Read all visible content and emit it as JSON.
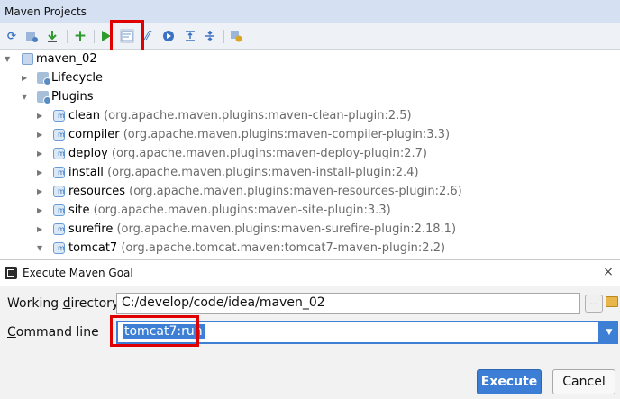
{
  "panel": {
    "title": "Maven Projects"
  },
  "toolbar": {
    "icons": [
      "refresh-icon",
      "generate-sources-icon",
      "download-icon",
      "add-icon",
      "run-icon",
      "execute-goal-icon",
      "toggle-offline-icon",
      "skip-tests-icon",
      "expand-all-icon",
      "collapse-all-icon",
      "settings-icon"
    ],
    "colors": {
      "run": "#2e9b2e",
      "add": "#2e9b2e",
      "highlight": "#e00000"
    }
  },
  "tree": {
    "project": "maven_02",
    "lifecycle": "Lifecycle",
    "plugins": "Plugins",
    "plugin_list": [
      {
        "name": "clean",
        "coord": "(org.apache.maven.plugins:maven-clean-plugin:2.5)"
      },
      {
        "name": "compiler",
        "coord": "(org.apache.maven.plugins:maven-compiler-plugin:3.3)"
      },
      {
        "name": "deploy",
        "coord": "(org.apache.maven.plugins:maven-deploy-plugin:2.7)"
      },
      {
        "name": "install",
        "coord": "(org.apache.maven.plugins:maven-install-plugin:2.4)"
      },
      {
        "name": "resources",
        "coord": "(org.apache.maven.plugins:maven-resources-plugin:2.6)"
      },
      {
        "name": "site",
        "coord": "(org.apache.maven.plugins:maven-site-plugin:3.3)"
      },
      {
        "name": "surefire",
        "coord": "(org.apache.maven.plugins:maven-surefire-plugin:2.18.1)"
      },
      {
        "name": "tomcat7",
        "coord": "(org.apache.tomcat.maven:tomcat7-maven-plugin:2.2)"
      }
    ]
  },
  "dialog": {
    "title": "Execute Maven Goal",
    "close": "×",
    "working_directory_label_pre": "Working ",
    "working_directory_label_u": "d",
    "working_directory_label_post": "irectory",
    "working_directory_value": "C:/develop/code/idea/maven_02",
    "browse_label": "...",
    "command_line_label_u": "C",
    "command_line_label_post": "ommand line",
    "command_line_value": "tomcat7:run",
    "dropdown_glyph": "▼",
    "execute_label": "Execute",
    "cancel_label": "Cancel"
  }
}
